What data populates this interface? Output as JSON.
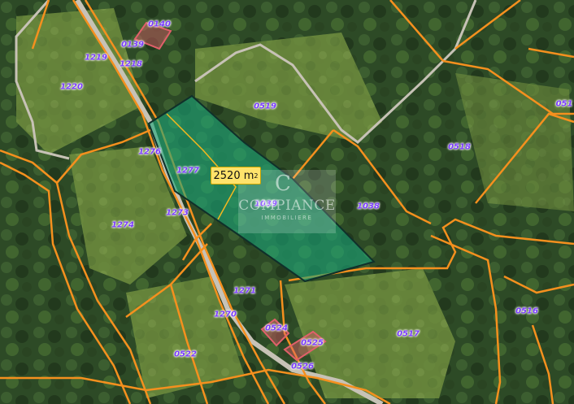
{
  "map": {
    "highlighted_parcel": {
      "id": "1039",
      "area_label": "2520 m",
      "area_unit_sup": "2",
      "fill": "#1aa67a",
      "outline": "#10302a"
    },
    "boundary_color": "#f5901e",
    "building_color": "#e0606a",
    "road_color": "#c7c2b6",
    "watermark": {
      "letter": "C",
      "name": "COMPIANCE",
      "subtitle": "IMMOBILIERE"
    },
    "parcels": [
      "0140",
      "0139",
      "1219",
      "1218",
      "1220",
      "0519",
      "0518",
      "051",
      "1276",
      "1277",
      "1039",
      "1038",
      "1274",
      "1273",
      "1271",
      "1270",
      "0516",
      "0524",
      "0525",
      "0517",
      "0522",
      "0526"
    ]
  }
}
